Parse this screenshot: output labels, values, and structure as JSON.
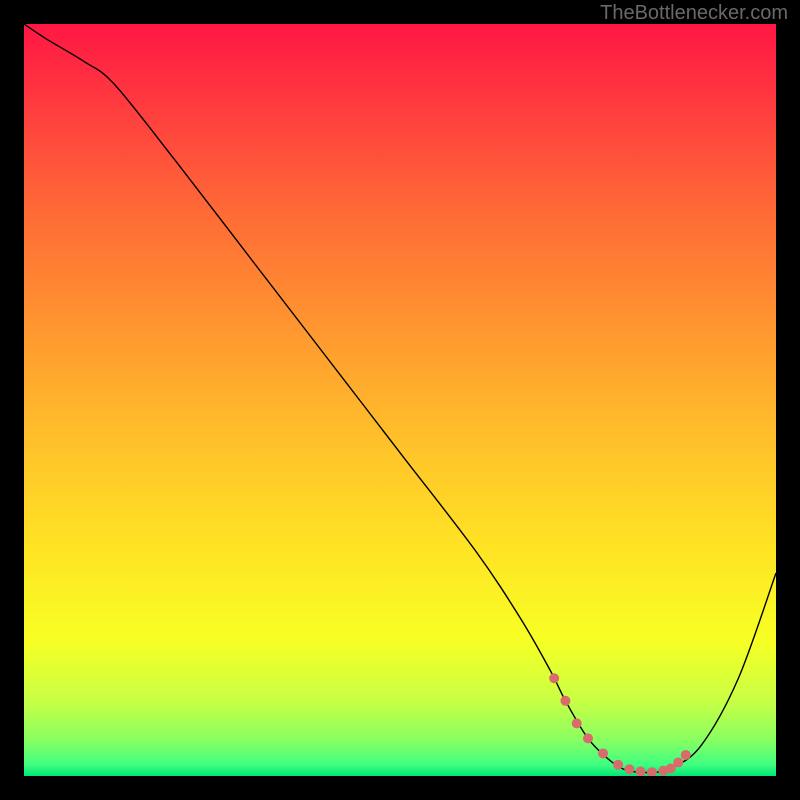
{
  "watermark": "TheBottlenecker.com",
  "chart_data": {
    "type": "line",
    "title": "",
    "xlabel": "",
    "ylabel": "",
    "xlim": [
      0,
      100
    ],
    "ylim": [
      0,
      100
    ],
    "background_gradient": {
      "stops": [
        {
          "offset": 0.0,
          "color": "#ff1744"
        },
        {
          "offset": 0.12,
          "color": "#ff3f3e"
        },
        {
          "offset": 0.25,
          "color": "#ff6a36"
        },
        {
          "offset": 0.4,
          "color": "#ff9530"
        },
        {
          "offset": 0.55,
          "color": "#ffc02a"
        },
        {
          "offset": 0.7,
          "color": "#ffe424"
        },
        {
          "offset": 0.82,
          "color": "#f7ff24"
        },
        {
          "offset": 0.9,
          "color": "#c8ff44"
        },
        {
          "offset": 0.95,
          "color": "#8cff60"
        },
        {
          "offset": 0.985,
          "color": "#40ff80"
        },
        {
          "offset": 1.0,
          "color": "#00e676"
        }
      ]
    },
    "series": [
      {
        "name": "curve",
        "color": "#000000",
        "stroke_width": 1.4,
        "x": [
          0,
          3,
          8,
          12,
          20,
          30,
          40,
          50,
          60,
          66,
          70,
          72,
          75,
          78,
          80,
          82,
          84,
          86,
          90,
          95,
          100
        ],
        "y": [
          100,
          98,
          95,
          92,
          82,
          69,
          56,
          43,
          30,
          21,
          14,
          10,
          5,
          2,
          0.8,
          0.5,
          0.5,
          1.0,
          4,
          13,
          27
        ]
      },
      {
        "name": "highlight-dots",
        "type": "scatter",
        "color": "#d86b6b",
        "marker_size": 10,
        "x": [
          70.5,
          72.0,
          73.5,
          75.0,
          77.0,
          79.0,
          80.5,
          82.0,
          83.5,
          85.0,
          86.0,
          87.0,
          88.0
        ],
        "y": [
          13.0,
          10.0,
          7.0,
          5.0,
          3.0,
          1.5,
          0.9,
          0.6,
          0.5,
          0.7,
          1.0,
          1.8,
          2.8
        ]
      }
    ]
  }
}
